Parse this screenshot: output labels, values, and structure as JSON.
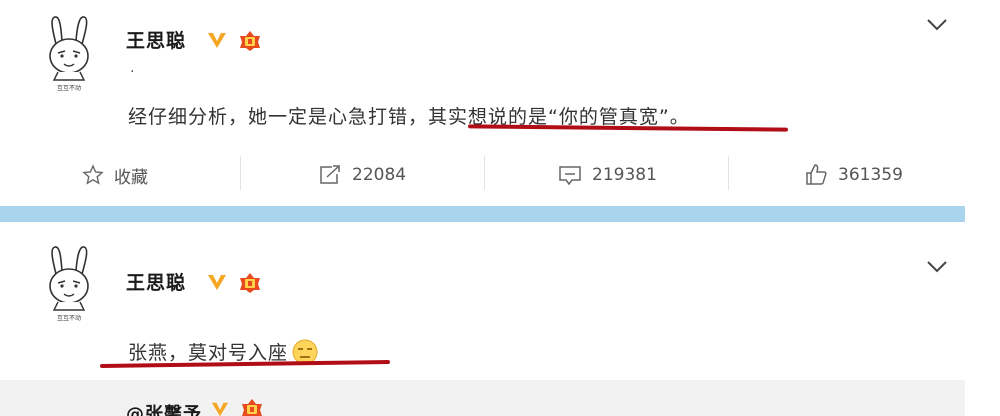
{
  "posts": [
    {
      "username": "王思聪",
      "dot": ".",
      "text": "经仔细分析，她一定是心急打错，其实想说的是“你的管真宽”。",
      "actions": {
        "favorite_label": "收藏",
        "repost_count": "22084",
        "comment_count": "219381",
        "like_count": "361359"
      }
    },
    {
      "username": "王思聪",
      "text": "张燕，莫对号入座"
    }
  ],
  "quoted": {
    "username": "@张馨予"
  },
  "icons": {
    "verified": "verified-v-icon",
    "level": "vip-level-icon",
    "menu": "chevron-down-icon",
    "favorite": "star-icon",
    "repost": "repost-icon",
    "comment": "comment-icon",
    "like": "thumbs-up-icon",
    "emoji": "awkward-face-emoji"
  },
  "colors": {
    "divider": "#aad3ee",
    "underline": "#b00d16",
    "verified": "#f5a623",
    "level": "#e8491d",
    "quote_bg": "#f2f2f2"
  }
}
